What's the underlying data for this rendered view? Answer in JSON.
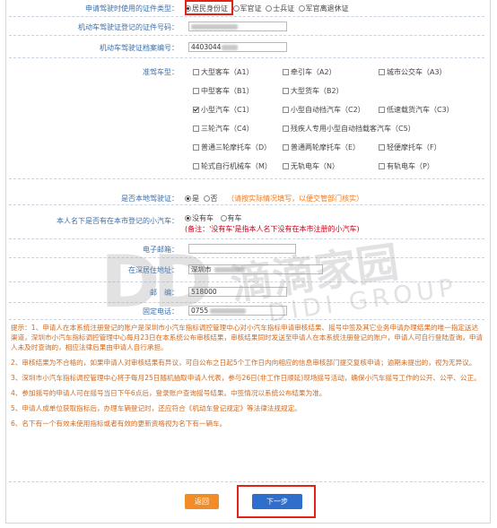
{
  "id_type": {
    "label": "申请驾驶时使用的证件类型：",
    "options": [
      "居民身份证",
      "军官证",
      "士兵证",
      "军官离退休证"
    ],
    "selected": 0
  },
  "license_id_number": {
    "label": "机动车驾驶证登记的证件号码：",
    "value": ""
  },
  "license_file_number": {
    "label": "机动车驾驶证档案编号：",
    "value": "4403044"
  },
  "vehicle_class": {
    "label": "准驾车型：",
    "options": [
      {
        "label": "大型客车（A1）",
        "checked": false
      },
      {
        "label": "牵引车（A2）",
        "checked": false
      },
      {
        "label": "城市公交车（A3）",
        "checked": false
      },
      {
        "label": "中型客车（B1）",
        "checked": false
      },
      {
        "label": "大型货车（B2）",
        "checked": false
      },
      {
        "label": "小型汽车（C1）",
        "checked": true
      },
      {
        "label": "小型自动挡汽车（C2）",
        "checked": false
      },
      {
        "label": "低速载货汽车（C3）",
        "checked": false
      },
      {
        "label": "三轮汽车（C4）",
        "checked": false
      },
      {
        "label": "残疾人专用小型自动挡载客汽车（C5）",
        "checked": false
      },
      {
        "label": "普通三轮摩托车（D）",
        "checked": false
      },
      {
        "label": "普通两轮摩托车（E）",
        "checked": false
      },
      {
        "label": "轻便摩托车（F）",
        "checked": false
      },
      {
        "label": "轮式自行机械车（M）",
        "checked": false
      },
      {
        "label": "无轨电车（N）",
        "checked": false
      },
      {
        "label": "有轨电车（P）",
        "checked": false
      }
    ]
  },
  "local_license": {
    "label": "是否本地驾驶证：",
    "options": [
      "是",
      "否"
    ],
    "selected": 0,
    "hint": "（请按实际情况填写，以便交管部门核实）"
  },
  "own_car": {
    "label": "本人名下是否有在本市登记的小汽车：",
    "options": [
      "没有车",
      "有车"
    ],
    "selected": 0,
    "note": "(备注：'没有车'是指本人名下没有在本市注册的小汽车)"
  },
  "email": {
    "label": "电子邮箱：",
    "value": ""
  },
  "address": {
    "label": "在深居住地址：",
    "value": "深圳市"
  },
  "postcode": {
    "label": "邮　编：",
    "value": "518000"
  },
  "phone": {
    "label": "固定电话：",
    "value": "0755"
  },
  "tips": [
    "提示：1、申请人在本系统注册登记的账户是深圳市小汽车指标调控管理中心对小汽车指标申请审核结果、摇号中签及其它业务申请办理结果的唯一指定送达渠道，深圳市小汽车指标调控管理中心每月23日在本系统公布审核结果，审核结果同时发送至申请人在本系统注册登记的账户，申请人可自行登陆查询，申请人未及时查询的，相应法律后果由申请人自行承担。",
    "2、审核结果为不合格的，如果申请人对审核结果有异议，可自公布之日起5个工作日内向相应的信息审核部门提交复核申请；逾期未提出的，视为无异议。",
    "3、深圳市小汽车指标调控管理中心将于每月25日随机抽取申请人代表，参与26日(非工作日顺延)现场摇号活动，确保小汽车摇号工作的公开、公平、公正。",
    "4、参加摇号的申请人可在摇号当日下午6点后，登录账户查询摇号结果。中签情况以系统公布结果为准。",
    "5、申请人成单位获取指标后，办理车辆登记时，还应符合《机动车登记规定》等法律法规规定。",
    "6、名下有一个有效未使用指标或者有效的更新资格视为名下有一辆车。"
  ],
  "buttons": {
    "back": "返回",
    "next": "下一步"
  },
  "watermark": {
    "logo": "DD",
    "cn": "滴滴家园",
    "en": "DIDI GROUP"
  },
  "colors": {
    "label": "#3d6fa8",
    "tip": "#d2691e",
    "hint": "#f07a1f",
    "note": "#d0021b",
    "back": "#f28c28",
    "next": "#2f6fcb",
    "highlight": "#e2231a"
  }
}
